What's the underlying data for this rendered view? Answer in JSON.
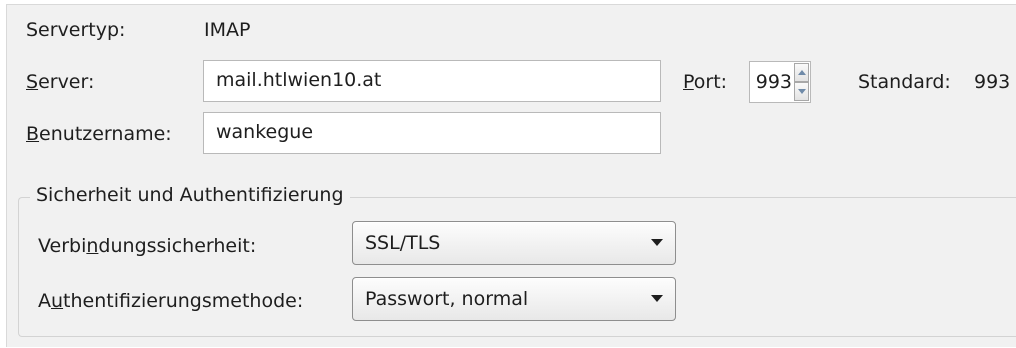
{
  "server": {
    "type_label": "Servertyp:",
    "type_value": "IMAP",
    "server_label_key": "S",
    "server_label_rest": "erver:",
    "server_value": "mail.htlwien10.at",
    "port_label_key": "P",
    "port_label_rest": "ort:",
    "port_value": "993",
    "standard_label": "Standard:",
    "standard_value": "993",
    "username_label_key": "B",
    "username_label_rest": "enutzername:",
    "username_value": "wankegue"
  },
  "security": {
    "group_title": "Sicherheit und Authentifizierung",
    "connection_label_pre": "Verbi",
    "connection_label_key": "n",
    "connection_label_post": "dungssicherheit:",
    "connection_value": "SSL/TLS",
    "auth_label_pre": "A",
    "auth_label_key": "u",
    "auth_label_post": "thentifizierungsmethode:",
    "auth_value": "Passwort, normal"
  }
}
